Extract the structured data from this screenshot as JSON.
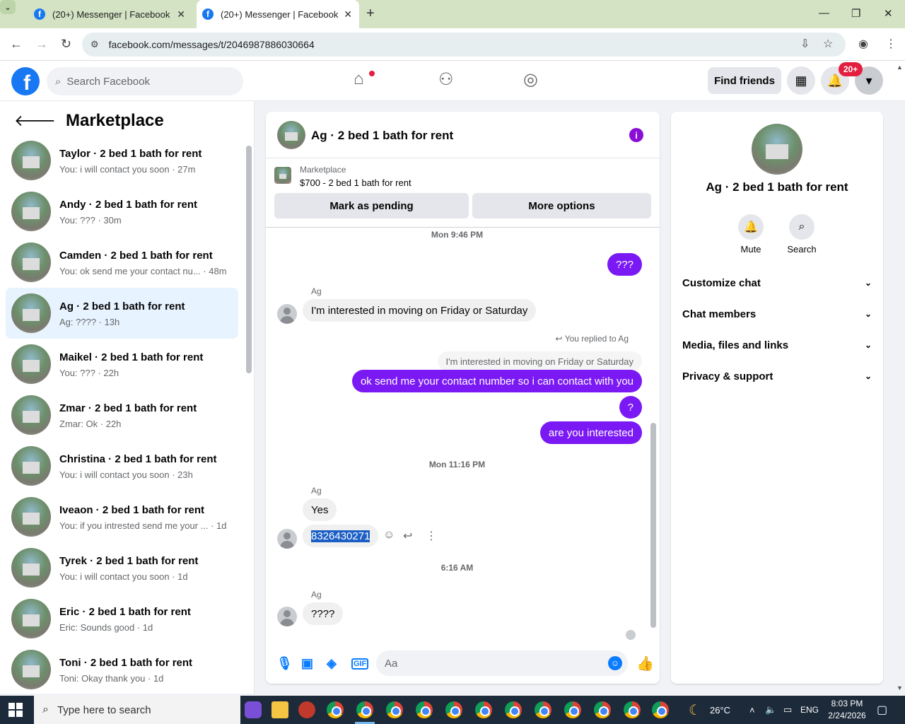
{
  "browser": {
    "tabs": [
      {
        "title": "(20+) Messenger | Facebook"
      },
      {
        "title": "(20+) Messenger | Facebook"
      }
    ],
    "url": "facebook.com/messages/t/2046987886030664"
  },
  "fb_header": {
    "search_placeholder": "Search Facebook",
    "find_friends_label": "Find friends",
    "notification_count": "20+"
  },
  "sidebar": {
    "title": "Marketplace",
    "conversations": [
      {
        "name": "Taylor · 2 bed 1 bath for rent",
        "preview": "You: i will contact you soon · 27m"
      },
      {
        "name": "Andy · 2 bed 1 bath for rent",
        "preview": "You: ??? · 30m"
      },
      {
        "name": "Camden · 2 bed 1 bath for rent",
        "preview": "You: ok send me your contact nu... · 48m"
      },
      {
        "name": "Ag · 2 bed 1 bath for rent",
        "preview": "Ag: ???? · 13h",
        "active": true
      },
      {
        "name": "Maikel · 2 bed 1 bath for rent",
        "preview": "You: ??? · 22h"
      },
      {
        "name": "Zmar · 2 bed 1 bath for rent",
        "preview": "Zmar: Ok · 22h"
      },
      {
        "name": "Christina · 2 bed 1 bath for rent",
        "preview": "You: i will contact you soon · 23h"
      },
      {
        "name": "Iveaon · 2 bed 1 bath for rent",
        "preview": "You: if you intrested send me your ... · 1d"
      },
      {
        "name": "Tyrek · 2 bed 1 bath for rent",
        "preview": "You: i will contact you soon · 1d"
      },
      {
        "name": "Eric · 2 bed 1 bath for rent",
        "preview": "Eric: Sounds good · 1d"
      },
      {
        "name": "Toni · 2 bed 1 bath for rent",
        "preview": "Toni: Okay thank you · 1d"
      }
    ]
  },
  "chat": {
    "title": "Ag · 2 bed 1 bath for rent",
    "listing_source": "Marketplace",
    "listing_price": "$700 - 2 bed 1 bath for rent",
    "mark_pending_label": "Mark as pending",
    "more_options_label": "More options",
    "messages": {
      "ts1": "Mon 9:46 PM",
      "out1": "???",
      "sender": "Ag",
      "in1": "I'm interested in moving on Friday or Saturday",
      "reply_note": "You replied to Ag",
      "reply_quote": "I'm interested in moving on Friday or Saturday",
      "out2": "ok  send me your contact number so i can contact with you",
      "out3": "?",
      "out4": "are you interested",
      "ts2": "Mon 11:16 PM",
      "in2": "Yes",
      "in3": "8326430271",
      "ts3": "6:16 AM",
      "in4": "????"
    },
    "composer_placeholder": "Aa"
  },
  "right_panel": {
    "title": "Ag · 2 bed 1 bath for rent",
    "mute_label": "Mute",
    "search_label": "Search",
    "sections": [
      "Customize chat",
      "Chat members",
      "Media, files and links",
      "Privacy & support"
    ]
  },
  "taskbar": {
    "search_placeholder": "Type here to search",
    "temperature": "26°C",
    "language": "ENG",
    "time": "8:03 PM",
    "date": "2/24/2026"
  }
}
